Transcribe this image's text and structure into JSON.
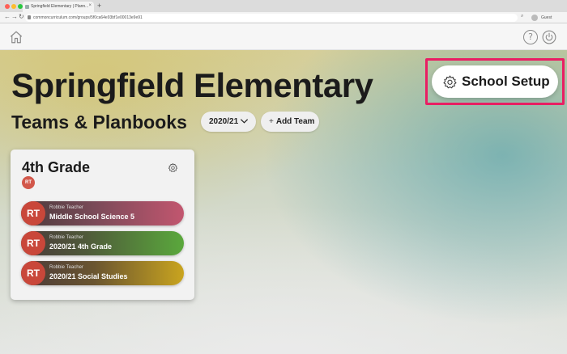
{
  "browser": {
    "tab_title": "Springfield Elementary | Plann...",
    "tab_close": "×",
    "new_tab": "+",
    "url": "commoncurriculum.com/groups/5f0ca64e93bf1e00013e9e91",
    "profile_label": "Guest",
    "colors": {
      "close": "#ff5f57",
      "minimize": "#febc2e",
      "maximize": "#28c840"
    }
  },
  "header": {
    "home_icon": "home-icon",
    "help_icon": "help-icon",
    "help_symbol": "?",
    "power_icon": "power-icon"
  },
  "page": {
    "title": "Springfield Elementary",
    "subtitle": "Teams & Planbooks",
    "year_selected": "2020/21",
    "add_team_label": "Add Team",
    "add_team_symbol": "+",
    "school_setup_label": "School Setup"
  },
  "team": {
    "name": "4th Grade",
    "member_initials": "RT",
    "planbooks": [
      {
        "initials": "RT",
        "owner": "Robbie Teacher",
        "name": "Middle School Science 5",
        "color": "#c2566f"
      },
      {
        "initials": "RT",
        "owner": "Robbie Teacher",
        "name": "2020/21 4th Grade",
        "color": "#5aa83c"
      },
      {
        "initials": "RT",
        "owner": "Robbie Teacher",
        "name": "2020/21 Social Studies",
        "color": "#c9a41f"
      }
    ]
  },
  "accent": {
    "highlight": "#e91e63",
    "avatar": "#c9473a"
  }
}
